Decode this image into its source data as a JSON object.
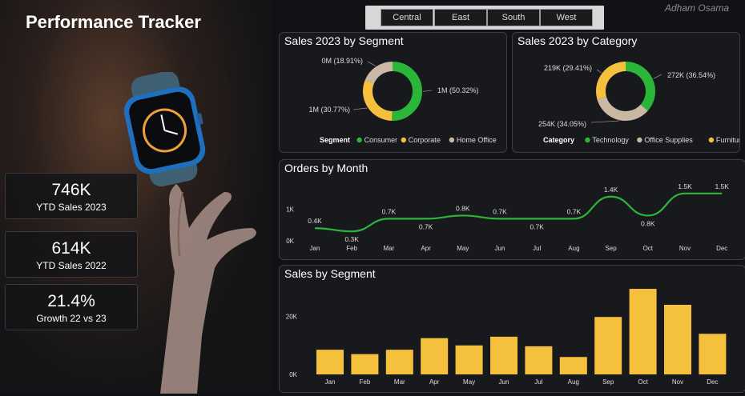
{
  "title": "Performance Tracker",
  "author": "Adham Osama",
  "regions": [
    "Central",
    "East",
    "South",
    "West"
  ],
  "kpis": {
    "ytd_2023": {
      "value": "746K",
      "label": "YTD Sales 2023"
    },
    "ytd_2022": {
      "value": "614K",
      "label": "YTD Sales 2022"
    },
    "growth": {
      "value": "21.4%",
      "label": "Growth 22 vs 23"
    }
  },
  "colors": {
    "green": "#2bb63a",
    "yellow": "#f5c13d",
    "beige": "#c9b8a4"
  },
  "chart_data": [
    {
      "type": "pie",
      "title": "Sales 2023 by Segment",
      "legend_title": "Segment",
      "legend_position": "bottom",
      "slices": [
        {
          "name": "Consumer",
          "value": 50.32,
          "label": "1M (50.32%)",
          "color": "#2bb63a"
        },
        {
          "name": "Corporate",
          "value": 30.77,
          "label": "1M (30.77%)",
          "color": "#f5c13d"
        },
        {
          "name": "Home Office",
          "value": 18.91,
          "label": "0M (18.91%)",
          "color": "#c9b8a4"
        }
      ]
    },
    {
      "type": "pie",
      "title": "Sales 2023 by Category",
      "legend_title": "Category",
      "legend_position": "bottom",
      "slices": [
        {
          "name": "Technology",
          "value": 36.54,
          "label": "272K (36.54%)",
          "color": "#2bb63a"
        },
        {
          "name": "Office Supplies",
          "value": 34.05,
          "label": "254K (34.05%)",
          "color": "#c9b8a4"
        },
        {
          "name": "Furniture",
          "value": 29.41,
          "label": "219K (29.41%)",
          "color": "#f5c13d"
        }
      ]
    },
    {
      "type": "line",
      "title": "Orders by Month",
      "categories": [
        "Jan",
        "Feb",
        "Mar",
        "Apr",
        "May",
        "Jun",
        "Jul",
        "Aug",
        "Sep",
        "Oct",
        "Nov",
        "Dec"
      ],
      "values": [
        0.4,
        0.3,
        0.7,
        0.7,
        0.8,
        0.7,
        0.7,
        0.7,
        1.4,
        0.8,
        1.5,
        1.5
      ],
      "data_labels": [
        "0.4K",
        "0.3K",
        "0.7K",
        "0.7K",
        "0.8K",
        "0.7K",
        "0.7K",
        "0.7K",
        "1.4K",
        "0.8K",
        "1.5K",
        "1.5K"
      ],
      "y_ticks": [
        {
          "value": 0,
          "label": "0K"
        },
        {
          "value": 1,
          "label": "1K"
        }
      ],
      "ylim": [
        0,
        1.8
      ],
      "grid": false
    },
    {
      "type": "bar",
      "title": "Sales by Segment",
      "categories": [
        "Jan",
        "Feb",
        "Mar",
        "Apr",
        "May",
        "Jun",
        "Jul",
        "Aug",
        "Sep",
        "Oct",
        "Nov",
        "Dec"
      ],
      "values": [
        8.5,
        7,
        8.5,
        12.5,
        10,
        13,
        9.7,
        6,
        19.8,
        29.5,
        24,
        14
      ],
      "y_ticks": [
        {
          "value": 0,
          "label": "0K"
        },
        {
          "value": 20,
          "label": "20K"
        }
      ],
      "ylim": [
        0,
        32
      ],
      "grid": false
    }
  ]
}
